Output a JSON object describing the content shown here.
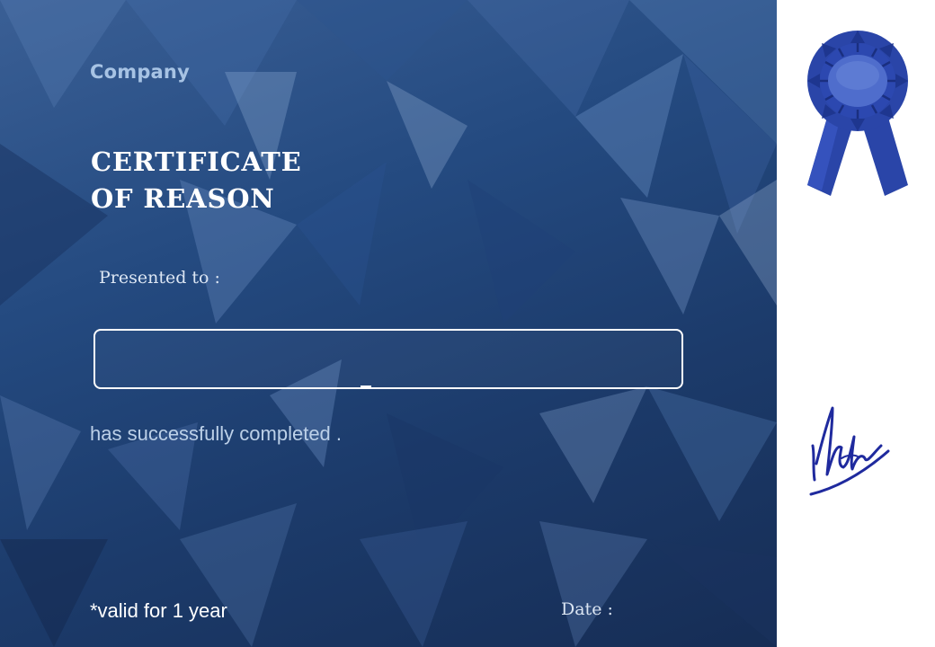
{
  "certificate": {
    "company": "Company",
    "title_line1": "CERTIFICATE",
    "title_line2": "OF REASON",
    "presented_label": "Presented to :",
    "recipient_name": "",
    "completion_text": "has successfully completed .",
    "validity_note": "*valid for 1 year",
    "date_label": "Date :"
  },
  "colors": {
    "background_dark": "#1c3b6b",
    "background_light": "#3a5f95",
    "company_text": "#a7c3e4",
    "title_text": "#ffffff",
    "ribbon_blue": "#2a45a8",
    "signature_ink": "#1f2a9e",
    "side_panel": "#ffffff"
  },
  "decorations": {
    "award_icon": "blue-ribbon-rosette",
    "signature_icon": "handwritten-signature"
  }
}
